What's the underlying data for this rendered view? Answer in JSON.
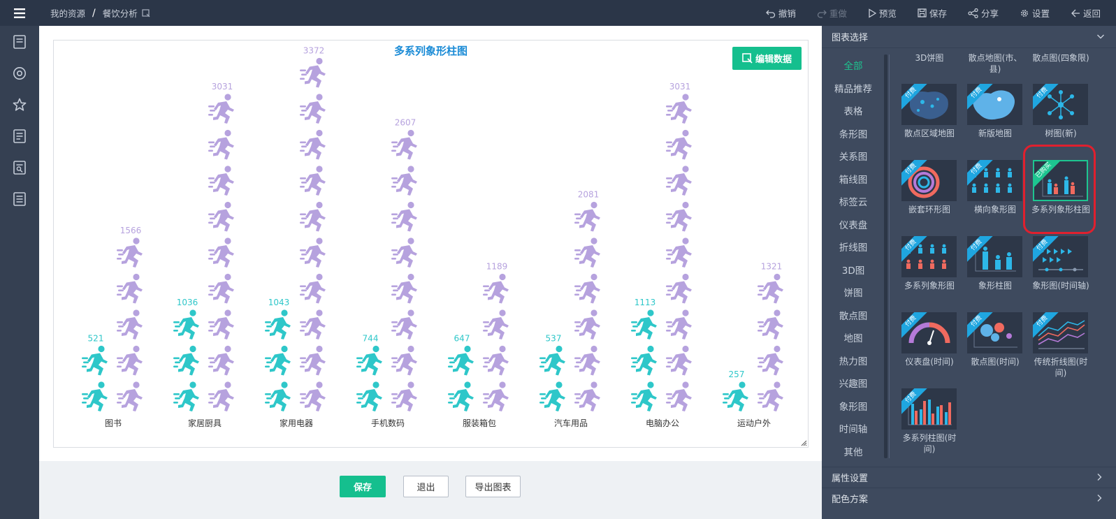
{
  "topbar": {
    "breadcrumb": [
      "我的资源",
      "/",
      "餐饮分析"
    ],
    "actions": {
      "undo": "撤销",
      "redo": "重做",
      "preview": "预览",
      "save": "保存",
      "share": "分享",
      "settings": "设置",
      "back": "返回"
    }
  },
  "left_nav": {
    "icons": [
      "dashboard-icon",
      "circle-target-icon",
      "star-icon",
      "report-icon",
      "search-report-icon",
      "list-doc-icon"
    ]
  },
  "canvas": {
    "edit_data_label": "编辑数据"
  },
  "chart_data": {
    "type": "pictorial-bar",
    "title": "多系列象形柱图",
    "categories": [
      "图书",
      "家居厨具",
      "家用电器",
      "手机数码",
      "服装箱包",
      "汽车用品",
      "电脑办公",
      "运动户外"
    ],
    "series": [
      {
        "color": "#2ec7c9",
        "values": [
          521,
          1036,
          1043,
          744,
          647,
          537,
          1113,
          257
        ]
      },
      {
        "color": "#b6a2de",
        "values": [
          1566,
          3031,
          3372,
          2607,
          1189,
          2081,
          3031,
          1321
        ]
      }
    ],
    "symbol": "running-person",
    "unit_per_symbol": 337
  },
  "bottom": {
    "save": "保存",
    "exit": "退出",
    "export": "导出图表"
  },
  "right_panel": {
    "header": "图表选择",
    "categories": [
      "全部",
      "精品推荐",
      "表格",
      "条形图",
      "关系图",
      "箱线图",
      "标签云",
      "仪表盘",
      "折线图",
      "3D图",
      "饼图",
      "散点图",
      "地图",
      "热力图",
      "兴趣图",
      "象形图",
      "时间轴",
      "其他"
    ],
    "active_category": "全部",
    "top_labels": [
      "3D饼图",
      "散点地图(市、县)",
      "散点图(四象限)"
    ],
    "tiles": [
      {
        "label": "散点区域地图",
        "badge": "付费",
        "icon": "scatter-region-map-icon"
      },
      {
        "label": "新版地图",
        "badge": "付费",
        "icon": "china-map-icon"
      },
      {
        "label": "树图(新)",
        "badge": "付费",
        "icon": "tree-graph-icon"
      },
      {
        "label": "嵌套环形图",
        "badge": "付费",
        "icon": "nested-ring-icon"
      },
      {
        "label": "横向象形图",
        "badge": "付费",
        "icon": "horizontal-pictorial-icon"
      },
      {
        "label": "多系列象形柱图",
        "badge": "已购买",
        "icon": "multi-pictorial-bar-icon",
        "selected": true
      },
      {
        "label": "多系列象形图",
        "badge": "付费",
        "icon": "multi-pictorial-icon"
      },
      {
        "label": "象形柱图",
        "badge": "付费",
        "icon": "pictorial-bar-icon"
      },
      {
        "label": "象形图(时间轴)",
        "badge": "付费",
        "icon": "pictorial-timeline-icon"
      },
      {
        "label": "仪表盘(时间)",
        "badge": "付费",
        "icon": "gauge-time-icon"
      },
      {
        "label": "散点图(时间)",
        "badge": "付费",
        "icon": "scatter-time-icon"
      },
      {
        "label": "传统折线图(时间)",
        "badge": "付费",
        "icon": "line-time-icon"
      },
      {
        "label": "多系列柱图(时间)",
        "badge": "付费",
        "icon": "multi-bar-time-icon"
      }
    ],
    "sections": [
      "属性设置",
      "配色方案"
    ]
  }
}
